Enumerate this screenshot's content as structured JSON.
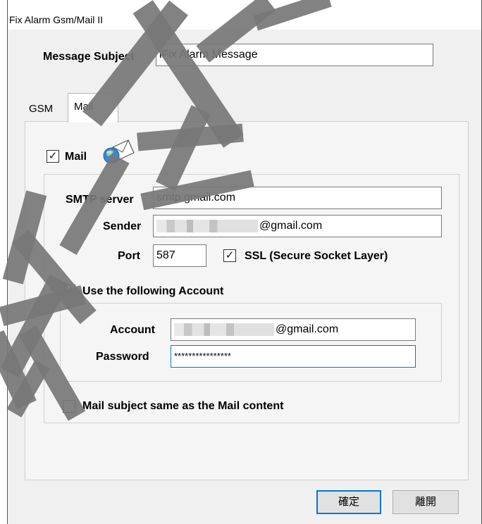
{
  "window": {
    "title": "Fix Alarm Gsm/Mail II"
  },
  "message_subject": {
    "label": "Message  Subject",
    "value": "iFix Alarm Message"
  },
  "tabs": [
    {
      "label": "GSM"
    },
    {
      "label": "Mail"
    }
  ],
  "mail_section": {
    "checkbox_label": "Mail",
    "checked": true
  },
  "smtp": {
    "server_label": "SMTP server",
    "server_value": "smtp.gmail.com",
    "sender_label": "Sender",
    "sender_domain": "@gmail.com",
    "port_label": "Port",
    "port_value": "587",
    "ssl_label": "SSL (Secure Socket Layer)",
    "ssl_checked": true
  },
  "account_section": {
    "checkbox_label": "Use the following Account",
    "checked": true,
    "account_label": "Account",
    "account_domain": "@gmail.com",
    "password_label": "Password",
    "password_value": "****************"
  },
  "mail_subject_same": {
    "label": "Mail subject same as the Mail content",
    "checked": false
  },
  "buttons": {
    "ok": "確定",
    "cancel": "離開"
  },
  "checkmark": "✓"
}
